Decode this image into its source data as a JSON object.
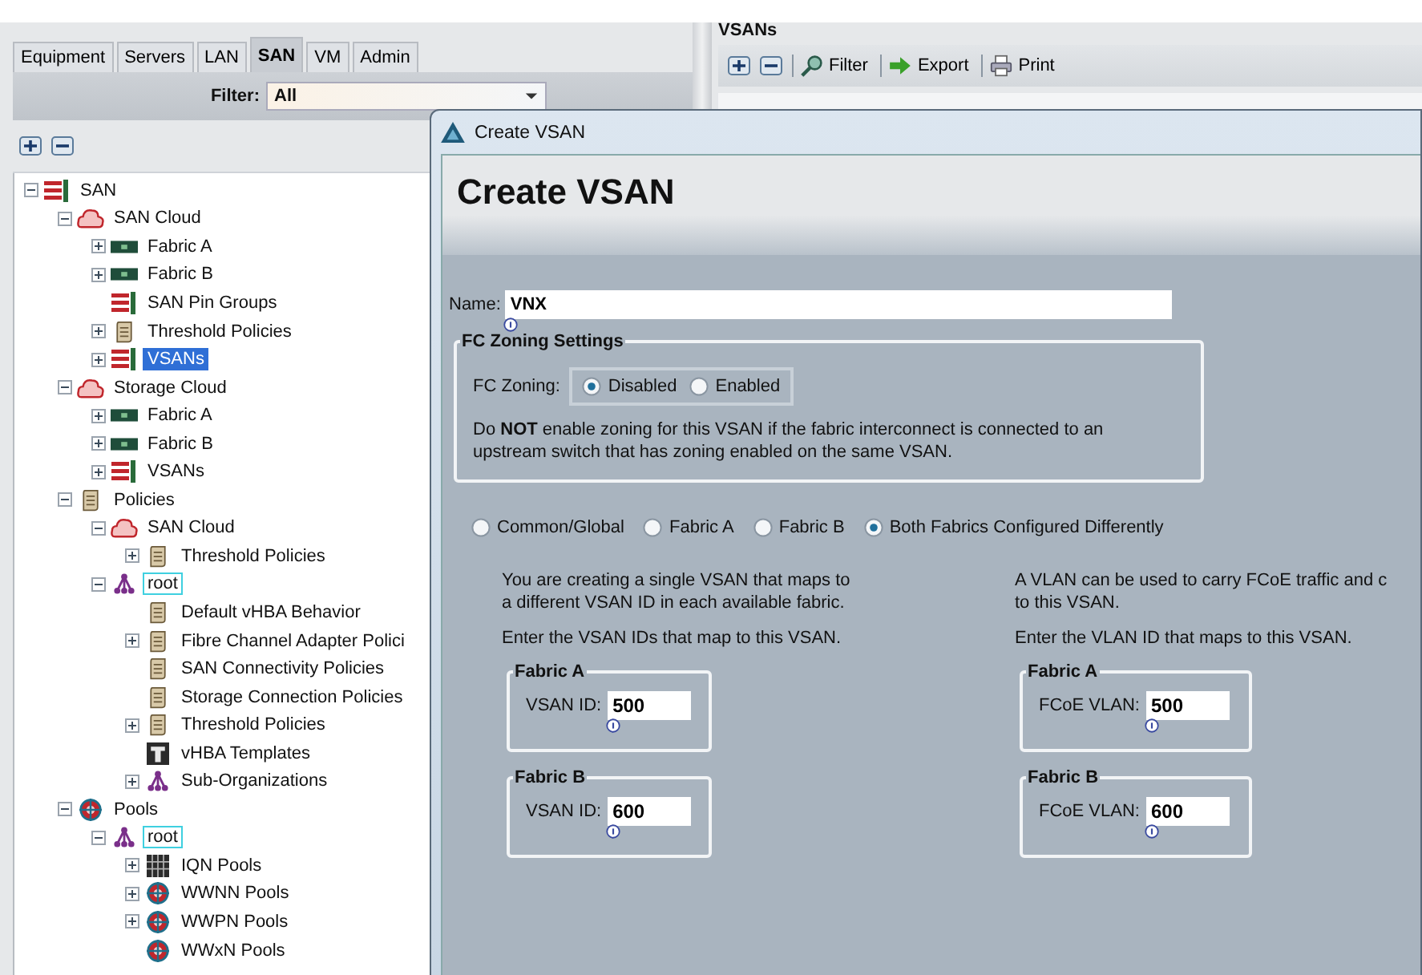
{
  "left_panel": {
    "tabs": [
      {
        "label": "Equipment",
        "selected": false
      },
      {
        "label": "Servers",
        "selected": false
      },
      {
        "label": "LAN",
        "selected": false
      },
      {
        "label": "SAN",
        "selected": true
      },
      {
        "label": "VM",
        "selected": false
      },
      {
        "label": "Admin",
        "selected": false
      }
    ],
    "filter": {
      "label": "Filter:",
      "value": "All"
    },
    "tree": [
      {
        "label": "SAN",
        "kind": "rack",
        "expanded": true,
        "selected": false,
        "outlined": false,
        "children": [
          {
            "label": "SAN Cloud",
            "kind": "cloud",
            "expanded": true,
            "selected": false,
            "outlined": false,
            "children": [
              {
                "label": "Fabric A",
                "kind": "fabric",
                "expanded": false,
                "selected": false,
                "outlined": false
              },
              {
                "label": "Fabric B",
                "kind": "fabric",
                "expanded": false,
                "selected": false,
                "outlined": false
              },
              {
                "label": "SAN Pin Groups",
                "kind": "rack",
                "selected": false,
                "outlined": false
              },
              {
                "label": "Threshold Policies",
                "kind": "policy",
                "expanded": false,
                "selected": false,
                "outlined": false
              },
              {
                "label": "VSANs",
                "kind": "rack",
                "expanded": false,
                "selected": true,
                "outlined": false
              }
            ]
          },
          {
            "label": "Storage Cloud",
            "kind": "cloud",
            "expanded": true,
            "selected": false,
            "outlined": false,
            "children": [
              {
                "label": "Fabric A",
                "kind": "fabric",
                "expanded": false,
                "selected": false,
                "outlined": false
              },
              {
                "label": "Fabric B",
                "kind": "fabric",
                "expanded": false,
                "selected": false,
                "outlined": false
              },
              {
                "label": "VSANs",
                "kind": "rack",
                "expanded": false,
                "selected": false,
                "outlined": false
              }
            ]
          },
          {
            "label": "Policies",
            "kind": "policy",
            "expanded": true,
            "selected": false,
            "outlined": false,
            "children": [
              {
                "label": "SAN Cloud",
                "kind": "cloud",
                "expanded": true,
                "selected": false,
                "outlined": false,
                "children": [
                  {
                    "label": "Threshold Policies",
                    "kind": "policy",
                    "expanded": false,
                    "selected": false,
                    "outlined": false
                  }
                ]
              },
              {
                "label": "root",
                "kind": "org",
                "expanded": true,
                "selected": false,
                "outlined": true,
                "children": [
                  {
                    "label": "Default vHBA Behavior",
                    "kind": "policy",
                    "selected": false,
                    "outlined": false
                  },
                  {
                    "label": "Fibre Channel Adapter Polici",
                    "kind": "policy",
                    "expanded": false,
                    "selected": false,
                    "outlined": false
                  },
                  {
                    "label": "SAN Connectivity Policies",
                    "kind": "policy",
                    "selected": false,
                    "outlined": false
                  },
                  {
                    "label": "Storage Connection Policies",
                    "kind": "policy",
                    "selected": false,
                    "outlined": false
                  },
                  {
                    "label": "Threshold Policies",
                    "kind": "policy",
                    "expanded": false,
                    "selected": false,
                    "outlined": false
                  },
                  {
                    "label": "vHBA Templates",
                    "kind": "template",
                    "selected": false,
                    "outlined": false
                  },
                  {
                    "label": "Sub-Organizations",
                    "kind": "org",
                    "expanded": false,
                    "selected": false,
                    "outlined": false
                  }
                ]
              }
            ]
          },
          {
            "label": "Pools",
            "kind": "pool",
            "expanded": true,
            "selected": false,
            "outlined": false,
            "children": [
              {
                "label": "root",
                "kind": "org",
                "expanded": true,
                "selected": false,
                "outlined": true,
                "children": [
                  {
                    "label": "IQN Pools",
                    "kind": "iqn",
                    "expanded": false,
                    "selected": false,
                    "outlined": false
                  },
                  {
                    "label": "WWNN Pools",
                    "kind": "pool",
                    "expanded": false,
                    "selected": false,
                    "outlined": false
                  },
                  {
                    "label": "WWPN Pools",
                    "kind": "pool",
                    "expanded": false,
                    "selected": false,
                    "outlined": false
                  },
                  {
                    "label": "WWxN Pools",
                    "kind": "pool",
                    "selected": false,
                    "outlined": false
                  }
                ]
              }
            ]
          }
        ]
      }
    ]
  },
  "right_panel": {
    "title": "VSANs",
    "toolbar": [
      {
        "kind": "add"
      },
      {
        "kind": "remove"
      },
      {
        "kind": "filter",
        "label": "Filter"
      },
      {
        "kind": "export",
        "label": "Export"
      },
      {
        "kind": "print",
        "label": "Print"
      }
    ]
  },
  "dialog": {
    "title": "Create VSAN",
    "heading": "Create VSAN",
    "name": {
      "label": "Name:",
      "value": "VNX"
    },
    "zoning": {
      "legend": "FC Zoning Settings",
      "label": "FC Zoning:",
      "options": [
        {
          "label": "Disabled",
          "selected": true
        },
        {
          "label": "Enabled",
          "selected": false
        }
      ],
      "note_lines": [
        "Do **NOT** enable zoning for this VSAN if the fabric interconnect is connected to an",
        "upstream switch that has zoning enabled on the same VSAN."
      ]
    },
    "modes": [
      {
        "label": "Common/Global",
        "selected": false
      },
      {
        "label": "Fabric A",
        "selected": false
      },
      {
        "label": "Fabric B",
        "selected": false
      },
      {
        "label": "Both Fabrics Configured Differently",
        "selected": true
      }
    ],
    "columns": [
      {
        "description_lines": [
          "You are creating a single VSAN that maps to",
          "a different VSAN ID in each available fabric."
        ],
        "instruction": "Enter the VSAN IDs that map to this VSAN.",
        "fabrics": [
          {
            "legend": "Fabric A",
            "label": "VSAN ID:",
            "value": "500"
          },
          {
            "legend": "Fabric B",
            "label": "VSAN ID:",
            "value": "600"
          }
        ]
      },
      {
        "description_lines": [
          "A VLAN can be used to carry FCoE traffic and c",
          "to this VSAN."
        ],
        "instruction": "Enter the VLAN ID that maps to this VSAN.",
        "fabrics": [
          {
            "legend": "Fabric A",
            "label": "FCoE VLAN:",
            "value": "500"
          },
          {
            "legend": "Fabric B",
            "label": "FCoE VLAN:",
            "value": "600"
          }
        ]
      }
    ]
  }
}
